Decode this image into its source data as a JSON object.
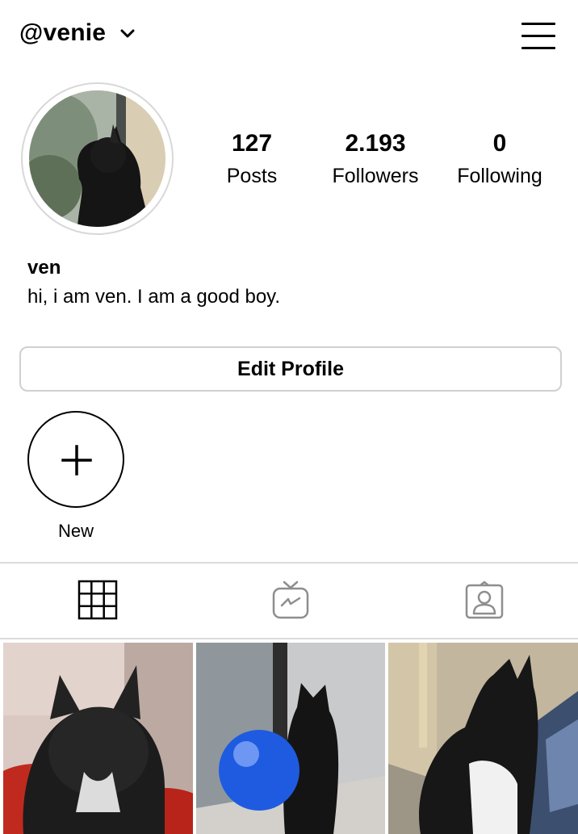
{
  "header": {
    "username": "@venie",
    "switch_account_icon": "chevron-down-icon",
    "menu_icon": "hamburger-menu-icon"
  },
  "profile": {
    "stats": [
      {
        "value": "127",
        "label": "Posts"
      },
      {
        "value": "2.193",
        "label": "Followers"
      },
      {
        "value": "0",
        "label": "Following"
      }
    ],
    "name": "ven",
    "bio": "hi, i am ven. I am a good boy.",
    "edit_button": "Edit Profile"
  },
  "highlights": {
    "new_label": "New",
    "new_icon": "plus-icon"
  },
  "tabs": [
    {
      "name": "posts-grid",
      "icon": "grid-icon",
      "active": true
    },
    {
      "name": "igtv",
      "icon": "igtv-icon",
      "active": false
    },
    {
      "name": "tagged",
      "icon": "tagged-person-icon",
      "active": false
    }
  ],
  "colors": {
    "text": "#000000",
    "border": "#dbdbdb",
    "icon_inactive": "#8e8e8e",
    "background": "#ffffff"
  }
}
